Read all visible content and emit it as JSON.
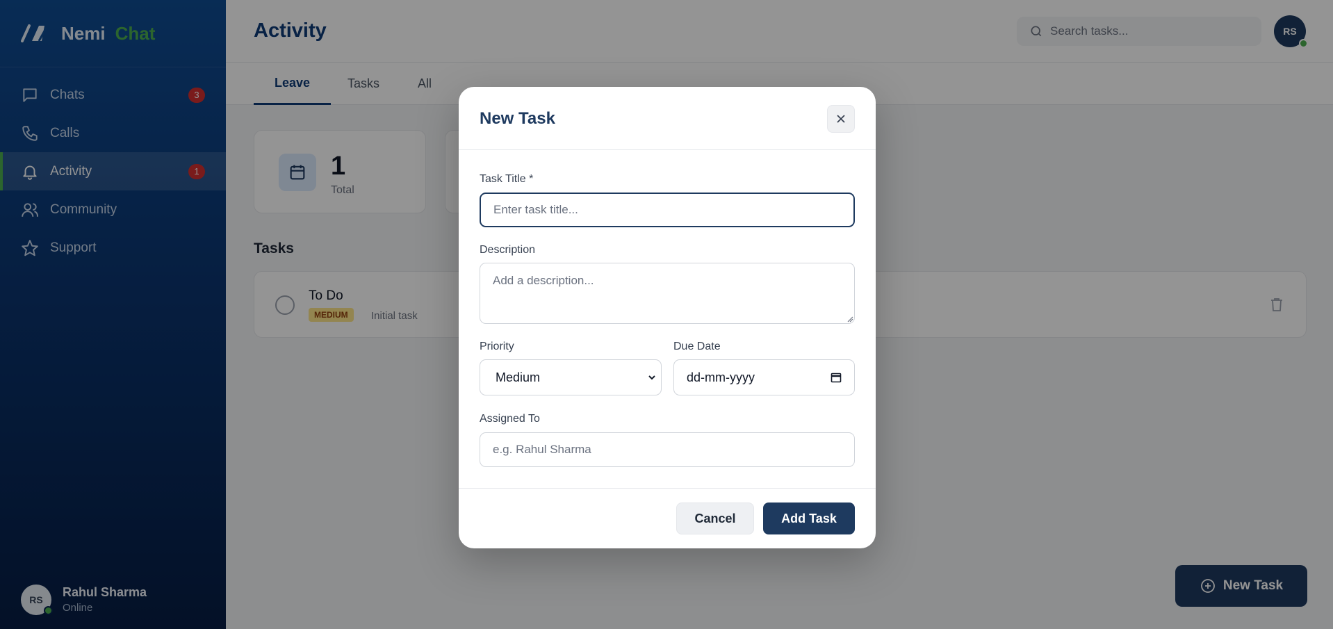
{
  "brand": {
    "name": "Nemi",
    "accent": "Chat",
    "logo_icon": "slash-a-logo",
    "accent_color": "#4caf50"
  },
  "sidebar": {
    "items": [
      {
        "label": "Chats",
        "icon": "chat-bubble-icon",
        "badge": "3"
      },
      {
        "label": "Calls",
        "icon": "phone-icon",
        "badge": ""
      },
      {
        "label": "Activity",
        "icon": "bell-icon",
        "badge": "1",
        "active": true
      },
      {
        "label": "Community",
        "icon": "users-icon",
        "badge": ""
      },
      {
        "label": "Support",
        "icon": "star-icon",
        "badge": ""
      }
    ],
    "user": {
      "initials": "RS",
      "name": "Rahul Sharma",
      "status": "Online"
    }
  },
  "header": {
    "title": "Activity",
    "search_placeholder": "Search tasks...",
    "avatar_initials": "RS"
  },
  "tabs": [
    {
      "label": "Leave",
      "active": true
    },
    {
      "label": "Tasks",
      "active": false
    },
    {
      "label": "All",
      "active": false
    }
  ],
  "stats": {
    "total_value": "1",
    "total_label": "Total"
  },
  "tasks_section": {
    "title": "Tasks",
    "items": [
      {
        "name": "To Do",
        "priority": "MEDIUM",
        "description": "Initial task"
      }
    ]
  },
  "fab": {
    "label": "New Task"
  },
  "modal": {
    "title": "New Task",
    "title_label": "Task Title *",
    "title_placeholder": "Enter task title...",
    "description_label": "Description",
    "description_placeholder": "Add a description...",
    "priority_label": "Priority",
    "priority_value": "Medium",
    "due_label": "Due Date",
    "due_placeholder": "dd-mm-yyyy",
    "assigned_label": "Assigned To",
    "assigned_placeholder": "e.g. Rahul Sharma",
    "cancel_label": "Cancel",
    "add_label": "Add Task"
  },
  "colors": {
    "primary": "#1e3a5f",
    "badge": "#d32f2f",
    "online": "#4caf50",
    "priority_medium": "#fde68a"
  }
}
